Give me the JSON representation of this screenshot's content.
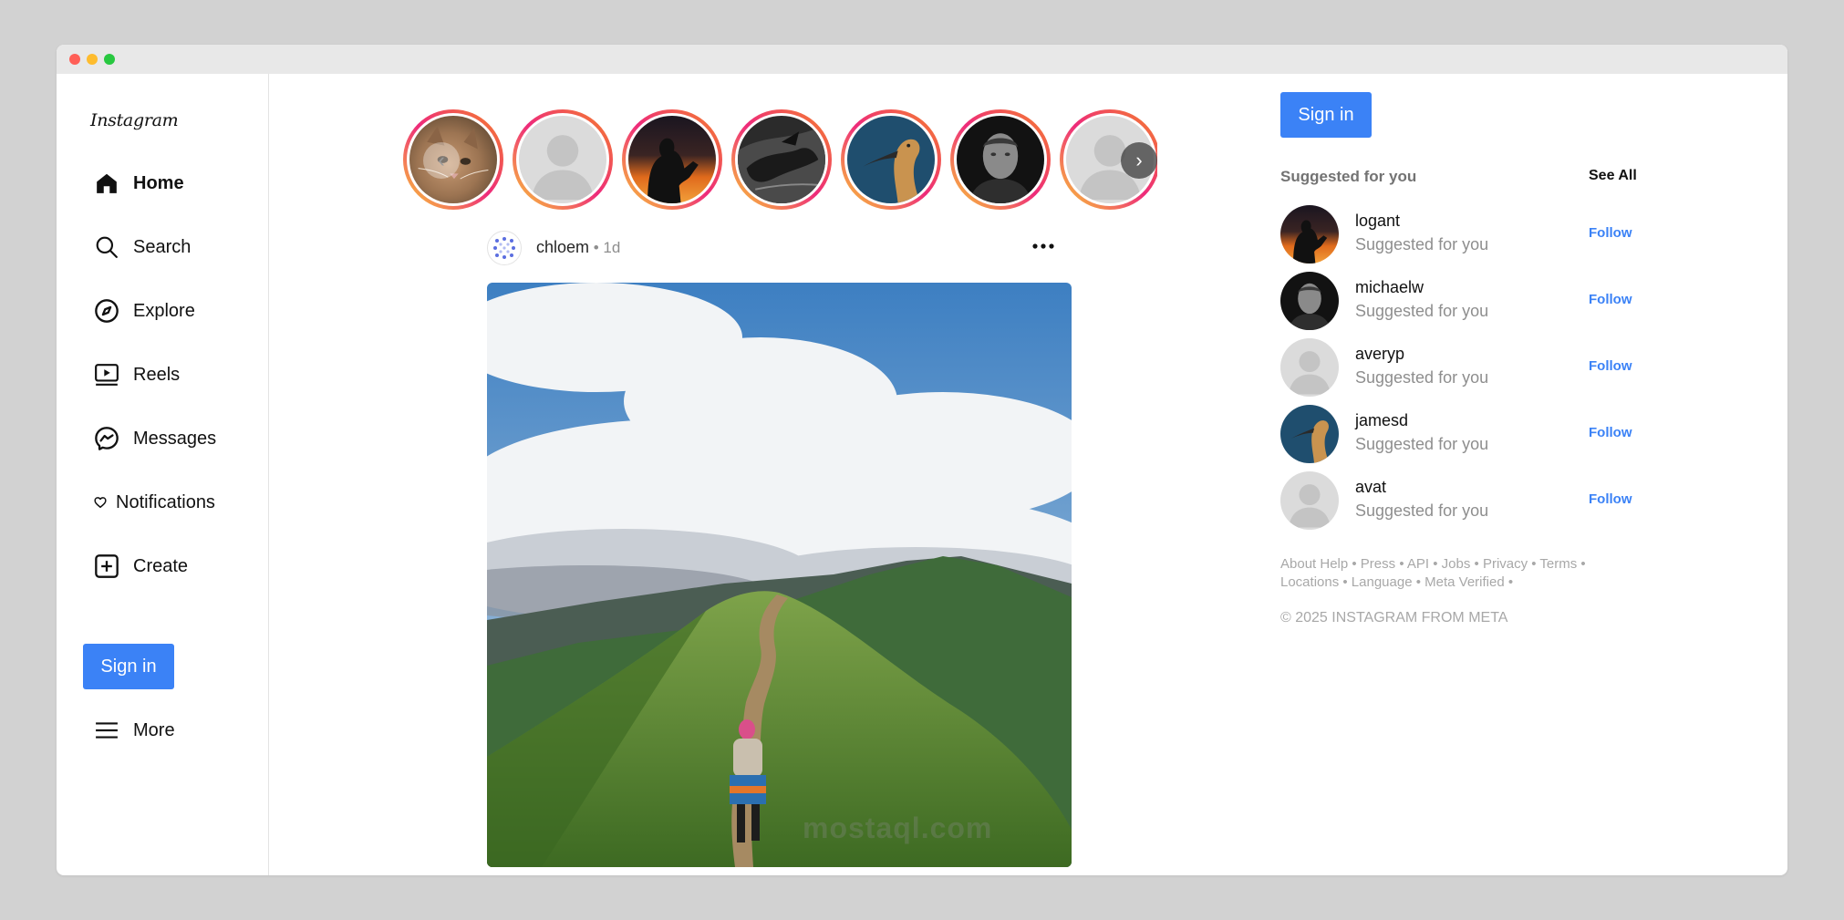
{
  "sidebar": {
    "logo": "Instagram",
    "items": [
      {
        "label": "Home",
        "icon": "home-icon"
      },
      {
        "label": "Search",
        "icon": "search-icon"
      },
      {
        "label": "Explore",
        "icon": "compass-icon"
      },
      {
        "label": "Reels",
        "icon": "reels-icon"
      },
      {
        "label": "Messages",
        "icon": "messenger-icon"
      },
      {
        "label": "Notifications",
        "icon": "heart-icon"
      },
      {
        "label": "Create",
        "icon": "plus-square-icon"
      }
    ],
    "signin_label": "Sign in",
    "more_label": "More"
  },
  "post": {
    "username": "chloem",
    "time": " • 1d"
  },
  "right": {
    "signin_label": "Sign in",
    "suggested_title": "Suggested for you",
    "see_all": "See All",
    "suggestions": [
      {
        "username": "logant",
        "subtitle": "Suggested for you",
        "follow": "Follow"
      },
      {
        "username": "michaelw",
        "subtitle": "Suggested for you",
        "follow": "Follow"
      },
      {
        "username": "averyp",
        "subtitle": "Suggested for you",
        "follow": "Follow"
      },
      {
        "username": "jamesd",
        "subtitle": "Suggested for you",
        "follow": "Follow"
      },
      {
        "username": "avat",
        "subtitle": "Suggested for you",
        "follow": "Follow"
      }
    ],
    "footer_line1": "About Help • Press • API • Jobs • Privacy • Terms •",
    "footer_line2": "Locations • Language • Meta Verified •",
    "copyright": "© 2025 INSTAGRAM FROM META"
  },
  "watermark": "mostaql.com",
  "colors": {
    "accent": "#3b82f6",
    "story_ring": "#ee2a7b"
  }
}
